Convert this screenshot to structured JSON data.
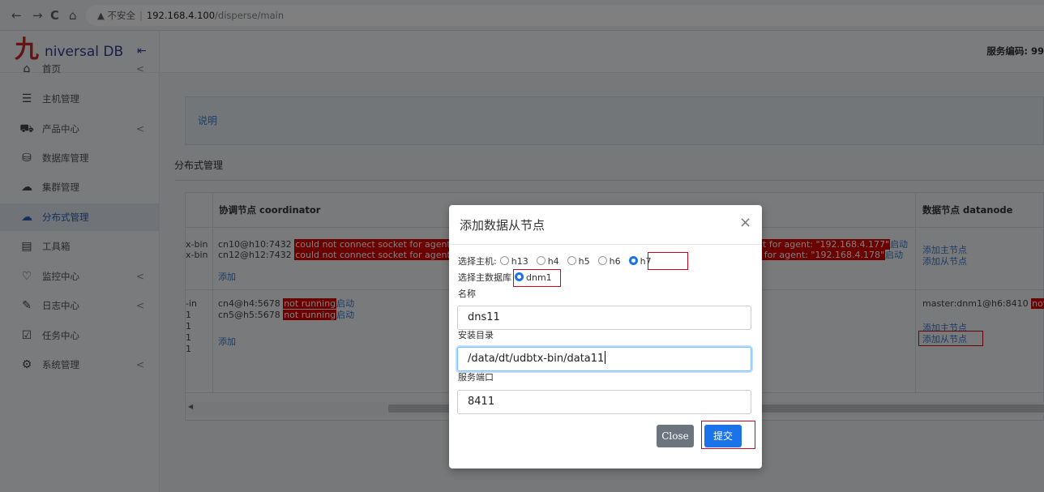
{
  "browser": {
    "back": "←",
    "forward": "→",
    "reload": "C",
    "home": "⌂",
    "warning_icon": "▲",
    "insecure_label": "不安全",
    "separator": "|",
    "host": "192.168.4.100",
    "path": "/disperse/main"
  },
  "sidebar": {
    "logo_mark": "九",
    "logo_text": "niversal DB",
    "collapse_icon": "⇤",
    "items": [
      {
        "label": "首页",
        "icon": "home-icon",
        "glyph": "⌂",
        "arrow": "<"
      },
      {
        "label": "主机管理",
        "icon": "server-icon",
        "glyph": "☰",
        "arrow": ""
      },
      {
        "label": "产品中心",
        "icon": "cart-icon",
        "glyph": "⛟",
        "arrow": "<"
      },
      {
        "label": "数据库管理",
        "icon": "database-icon",
        "glyph": "⛁",
        "arrow": ""
      },
      {
        "label": "集群管理",
        "icon": "cluster-icon",
        "glyph": "☁",
        "arrow": ""
      },
      {
        "label": "分布式管理",
        "icon": "distributed-icon",
        "glyph": "☁",
        "arrow": ""
      },
      {
        "label": "工具箱",
        "icon": "toolbox-icon",
        "glyph": "▤",
        "arrow": ""
      },
      {
        "label": "监控中心",
        "icon": "heart-icon",
        "glyph": "♡",
        "arrow": "<"
      },
      {
        "label": "日志中心",
        "icon": "log-icon",
        "glyph": "✎",
        "arrow": "<"
      },
      {
        "label": "任务中心",
        "icon": "task-icon",
        "glyph": "☑",
        "arrow": ""
      },
      {
        "label": "系统管理",
        "icon": "gear-icon",
        "glyph": "⚙",
        "arrow": "<"
      }
    ]
  },
  "header": {
    "service_code": "服务编码: 99"
  },
  "main": {
    "notice": "说明",
    "section_title": "分布式管理",
    "table": {
      "col_coordinator": "协调节点 coordinator",
      "col_datanode": "数据节点 datanode",
      "row1": {
        "left1": "x-bin",
        "left2": "x-bin",
        "cn1": "cn10@h10:7432",
        "cn1_err": "could not connect socket for agent",
        "cn2": "cn12@h12:7432",
        "cn2_err": "could not connect socket for agent",
        "add": "添加",
        "mid1_err": "ct for agent: \"192.168.4.177\"",
        "mid1_link": "启动",
        "mid2_err": "t for agent: \"192.168.4.178\"",
        "mid2_link": "启动",
        "dn_add_master": "添加主节点",
        "dn_add_slave": "添加从节点"
      },
      "row2": {
        "left1": "-in",
        "left2": "1",
        "left3": "1",
        "left4": "1",
        "left5": "1",
        "cn1": "cn4@h4:5678",
        "cn1_err": "not running",
        "cn1_link": "启动",
        "cn2": "cn5@h5:5678",
        "cn2_err": "not running",
        "cn2_link": "启动",
        "add": "添加",
        "dn_master": "master:dnm1@h6:8410",
        "dn_master_err": "not",
        "dn_add_master": "添加主节点",
        "dn_add_slave": "添加从节点"
      }
    }
  },
  "modal": {
    "title": "添加数据从节点",
    "close_icon": "×",
    "host_label": "选择主机:",
    "hosts": [
      "h13",
      "h4",
      "h5",
      "h6",
      "h7"
    ],
    "selected_host": "h7",
    "db_label": "选择主数据库",
    "db_option": "dnm1",
    "name_label": "名称",
    "name_value": "dns11",
    "dir_label": "安装目录",
    "dir_value": "/data/dt/udbtx-bin/data11",
    "port_label": "服务端口",
    "port_value": "8411",
    "close_button": "Close",
    "submit_button": "提交"
  }
}
